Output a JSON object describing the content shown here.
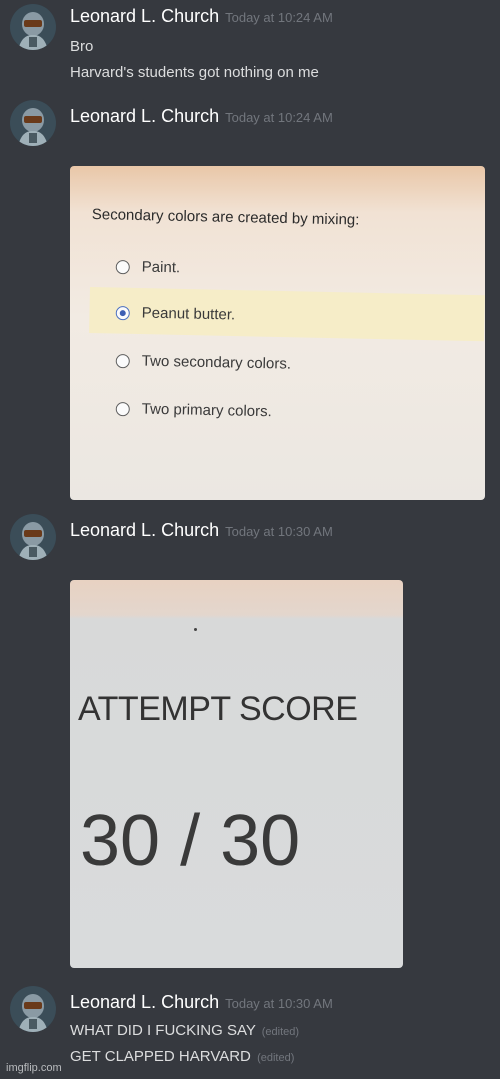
{
  "messages": [
    {
      "username": "Leonard L. Church",
      "timestamp": "Today at 10:24 AM",
      "lines": [
        {
          "text": "Bro"
        },
        {
          "text": "Harvard's students got nothing on me"
        }
      ]
    },
    {
      "username": "Leonard L. Church",
      "timestamp": "Today at 10:24 AM",
      "attachment": {
        "question": "Secondary colors are created by mixing:",
        "options": [
          {
            "label": "Paint.",
            "selected": false
          },
          {
            "label": "Peanut butter.",
            "selected": true
          },
          {
            "label": "Two secondary colors.",
            "selected": false
          },
          {
            "label": "Two primary colors.",
            "selected": false
          }
        ]
      }
    },
    {
      "username": "Leonard L. Church",
      "timestamp": "Today at 10:30 AM",
      "attachment": {
        "score_label": "ATTEMPT SCORE",
        "score_value": "30 / 30"
      }
    },
    {
      "username": "Leonard L. Church",
      "timestamp": "Today at 10:30 AM",
      "lines": [
        {
          "text": "WHAT DID I FUCKING SAY",
          "edited": "(edited)"
        },
        {
          "text": "GET CLAPPED HARVARD",
          "edited": "(edited)"
        }
      ]
    }
  ],
  "watermark": "imgflip.com",
  "colors": {
    "background": "#36393f",
    "username": "#ffffff",
    "timestamp": "#72767d",
    "text": "#dcddde",
    "radio_selected": "#3d5fb3"
  },
  "icons": [
    "avatar-helmet-icon"
  ]
}
